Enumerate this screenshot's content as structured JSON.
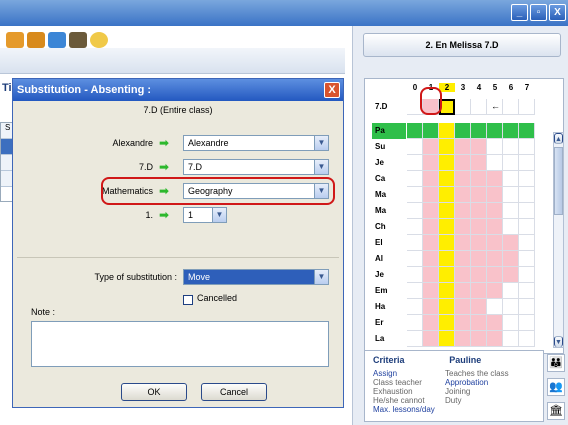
{
  "window": {
    "buttons": [
      "_",
      "▫",
      "X"
    ]
  },
  "left": {
    "label": "Ti",
    "rows": [
      "S",
      "",
      "",
      ""
    ]
  },
  "right": {
    "header": "2. En Melissa 7.D",
    "grid": {
      "columns": [
        "0",
        "1",
        "2",
        "3",
        "4",
        "5",
        "6",
        "7"
      ],
      "current_column": "2",
      "class_label": "7.D",
      "arrow": "←",
      "rows": [
        "Pa",
        "Su",
        "Je",
        "Ca",
        "Ma",
        "Ma",
        "Ch",
        "El",
        "Al",
        "Je",
        "Em",
        "Ha",
        "Er",
        "La"
      ]
    },
    "info": {
      "criteria_label": "Criteria",
      "person": "Pauline",
      "left_items": [
        "Assign",
        "Class teacher",
        "Exhaustion",
        "He/she cannot",
        "Max. lessons/day"
      ],
      "right_items": [
        "Teaches the class",
        "Approbation",
        "Joining",
        "Duty"
      ]
    },
    "scroll_up": "▲",
    "scroll_down": "▼"
  },
  "dialog": {
    "title": "Substitution - Absenting :",
    "close": "X",
    "subtitle": "7.D (Entire class)",
    "rows": [
      {
        "label": "Alexandre",
        "value": "Alexandre"
      },
      {
        "label": "7.D",
        "value": "7.D"
      },
      {
        "label": "Mathematics",
        "value": "Geography"
      },
      {
        "label": "1.",
        "value": "1"
      }
    ],
    "type_label": "Type of substitution :",
    "type_value": "Move",
    "cancelled_label": "Cancelled",
    "note_label": "Note :",
    "ok": "OK",
    "cancel": "Cancel"
  },
  "colors": {
    "accent": "#2e5fba",
    "green": "#2fbf4a",
    "pink": "#f9c2ca",
    "yellow": "#ffee00",
    "red": "#d01818"
  }
}
